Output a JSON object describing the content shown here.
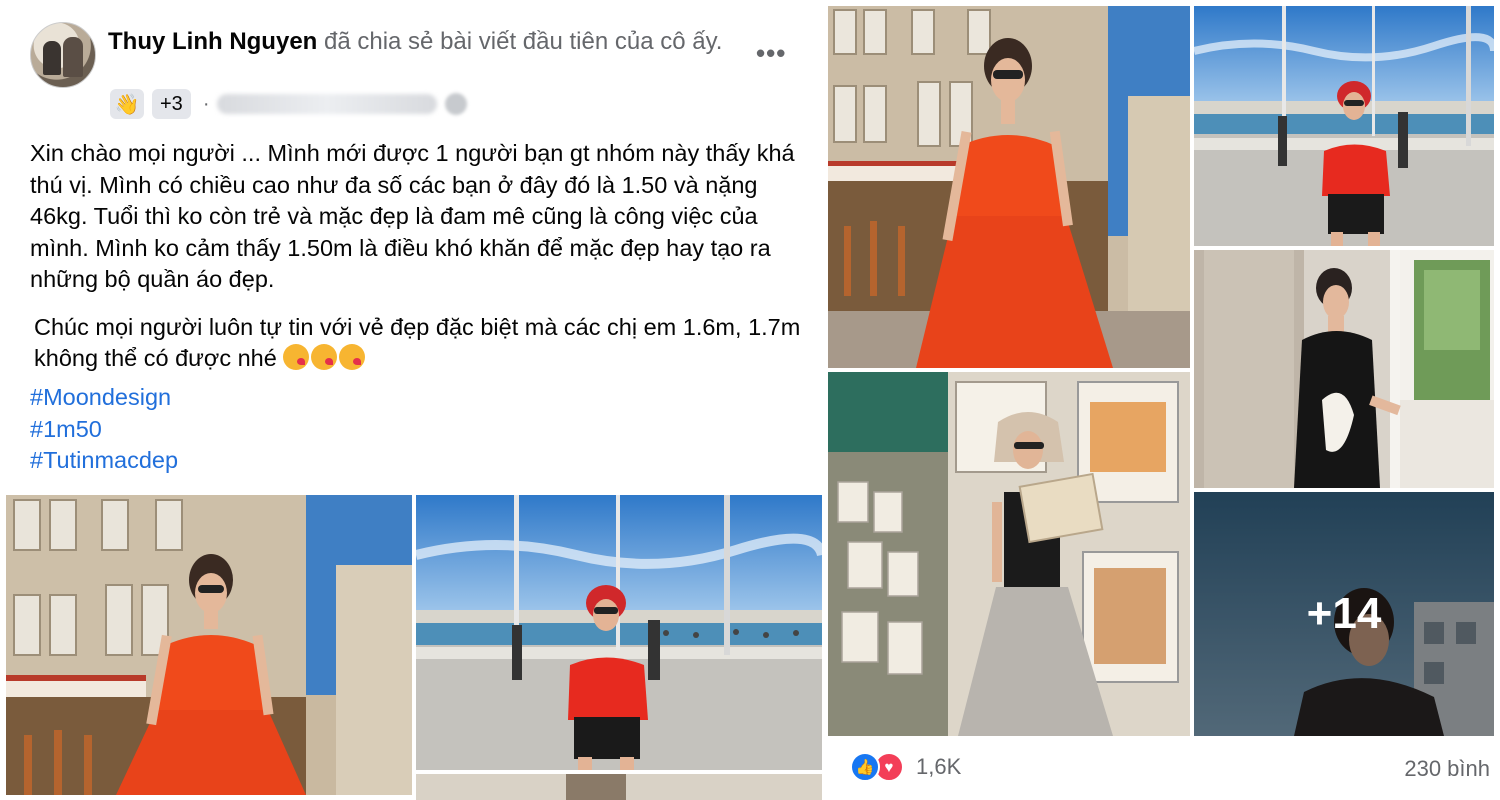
{
  "post": {
    "author": "Thuy Linh Nguyen",
    "action": " đã chia sẻ bài viết đầu tiên của cô ấy.",
    "more_icon": "more-horizontal-icon",
    "wave_icon": "waving-hand-icon",
    "badge_count": "+3",
    "paragraph1": "Xin chào mọi người ... Mình mới được 1 người bạn gt nhóm này thấy khá thú vị. Mình có chiều cao như đa số các bạn ở đây đó là 1.50 và nặng 46kg. Tuổi thì ko còn trẻ và mặc đẹp là đam mê cũng là công việc của mình. Mình ko cảm thấy 1.50m là điều khó khăn để mặc đẹp hay tạo ra những bộ quần áo đẹp.",
    "paragraph2": "Chúc mọi người luôn tự tin với vẻ đẹp đặc biệt mà các chị em 1.6m, 1.7m không thể có được nhé",
    "hashtags": [
      "#Moondesign",
      "#1m50",
      "#Tutinmacdep"
    ]
  },
  "gallery": {
    "more_count": "+14"
  },
  "footer": {
    "reaction_count": "1,6K",
    "comments": "230 bình",
    "like_icon": "like-icon",
    "love_icon": "love-icon"
  },
  "colors": {
    "link": "#216fdb",
    "meta": "#65676b",
    "dress_red": "#f04a1b"
  }
}
